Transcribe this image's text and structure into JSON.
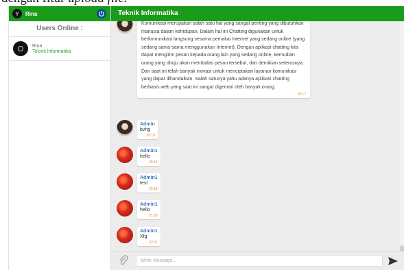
{
  "caption": {
    "text": "dengan fitur ",
    "italic": "upload file."
  },
  "sidebar": {
    "user_initial": "Y",
    "user_name": "Rina",
    "users_online_label": "Users Online :",
    "online_users": [
      {
        "name": "Rina",
        "subtitle": "Teknik Informatika"
      }
    ]
  },
  "chat": {
    "title": "Teknik Informatika",
    "long_message": {
      "text": "Komunikasi merupakan salah satu hal yang sangat penting yang dibutuhkan manusia dalam kehidupan. Dalam hal ini Chatting digunakan untuk berkomunikasi langsung sesama pemakai Internet yang sedang online (yang sedang sama-sama menggunakan Internet). Dengan aplikasi chatting kita dapat mengirim pesan kepada orang lain yang sedang online, kemudian orang yang dituju akan membalas pesan tersebut, dan demikian seterusnya. Dan saat ini telah banyak inovasi untuk menciptakan layanan komunikasi yang dapat dihandalkan. Salah satunya yaitu adanya aplikasi chatting berbasis web yang saat ini sangat digemari oleh banyak orang.",
      "time": "20:17"
    },
    "messages": [
      {
        "sender": "Admin",
        "text": "bvhg",
        "time": "20:18"
      },
      {
        "sender": "Admin1",
        "text": "hello",
        "time": "20:18"
      },
      {
        "sender": "Admin1",
        "text": "test",
        "time": "20:18"
      },
      {
        "sender": "Admin1",
        "text": "hello",
        "time": "21:28"
      },
      {
        "sender": "Admin1",
        "text": "Xfg",
        "time": "22:11"
      }
    ],
    "input_placeholder": "Write Message..."
  },
  "colors": {
    "header_green": "#1a9b1a",
    "name_blue": "#3a78c4",
    "time_orange": "#e08a3a"
  }
}
